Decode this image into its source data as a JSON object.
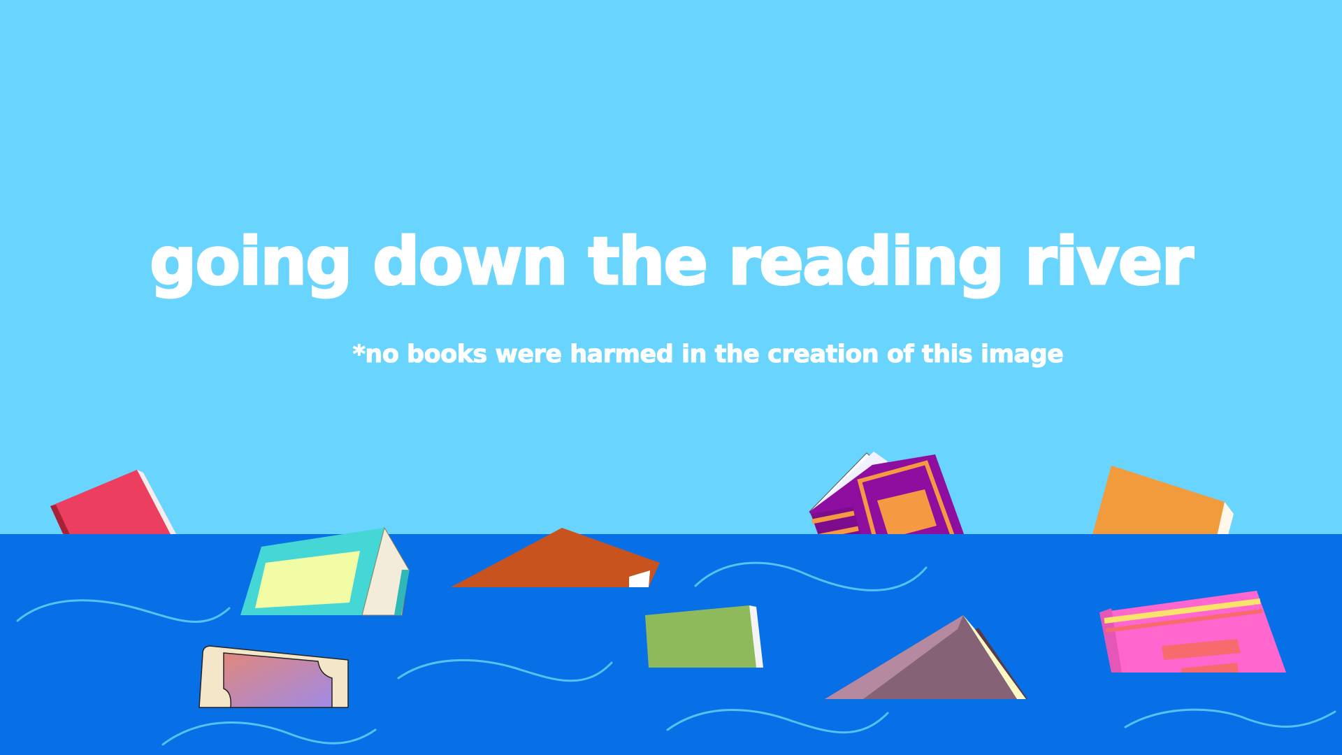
{
  "title": "going down the reading river",
  "subtitle": "*no books were harmed in the creation of this image",
  "colors": {
    "sky": "#69d5fe",
    "river": "#0870e6",
    "ripple": "#56c2f5",
    "text": "#ffffff"
  },
  "books": [
    {
      "name": "red-book",
      "color": "#ec3f5f"
    },
    {
      "name": "teal-open-book",
      "color": "#45d6d6"
    },
    {
      "name": "orange-triangle-book",
      "color": "#c8531f"
    },
    {
      "name": "green-book",
      "color": "#8fba5c"
    },
    {
      "name": "purple-open-book",
      "color": "#8e0ea0"
    },
    {
      "name": "mauve-triangle-book",
      "color": "#866276"
    },
    {
      "name": "orange-book",
      "color": "#f29b3c"
    },
    {
      "name": "pink-book",
      "color": "#ff67cf"
    },
    {
      "name": "gradient-book",
      "color": "#c78fba"
    }
  ]
}
